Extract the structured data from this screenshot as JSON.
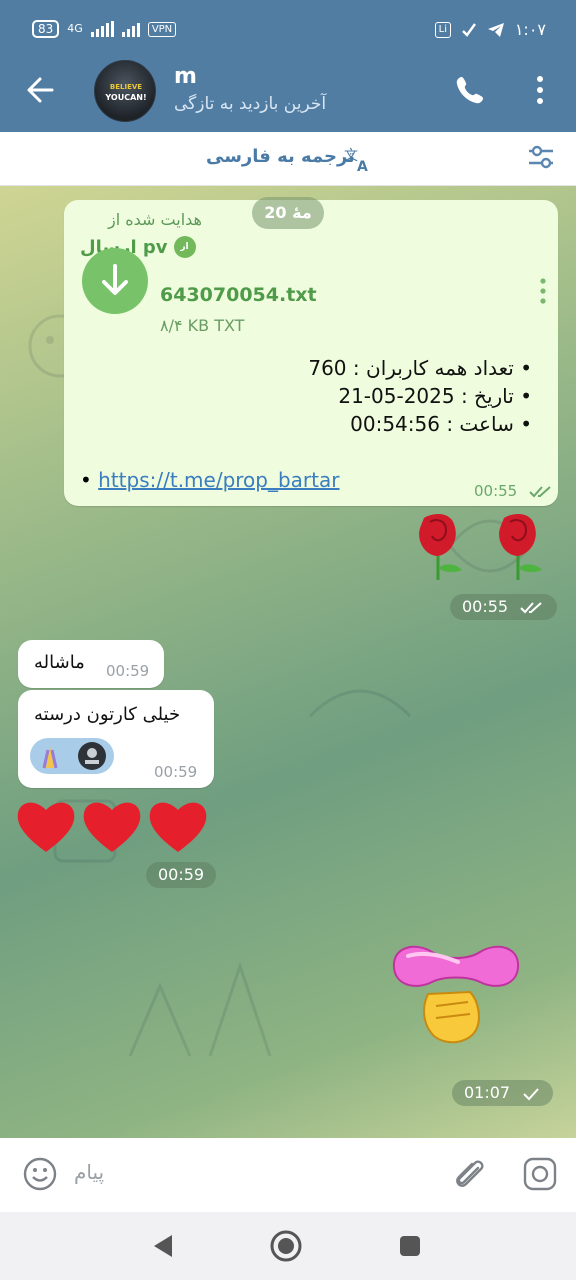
{
  "status_bar": {
    "battery": "83",
    "network": "4G",
    "vpn": "VPN",
    "app_badge": "Li",
    "time": "۱:۰۷"
  },
  "header": {
    "chat_name": "m",
    "last_seen": "آخرین بازدید به تازگی",
    "avatar_line1": "BELIEVE",
    "avatar_line2": "YOUCAN!"
  },
  "translate_bar": {
    "label": "ترجمه به فارسی"
  },
  "messages": {
    "date_pill": "20 مهٔ",
    "forward": {
      "forwarded_from_label": "هدایت شده از",
      "source_name": "ارسال pv",
      "source_badge": "ار",
      "file_name": "643070054.txt",
      "file_meta": "۸/۴ KB TXT",
      "info_lines": [
        "• تعداد همه کاربران : 760",
        "• تاریخ : 2025-05-21",
        "• ساعت : 00:54:56"
      ],
      "link_bullet": "•",
      "link": "https://t.me/prop_bartar",
      "time": "00:55"
    },
    "roses": {
      "time": "00:55"
    },
    "incoming_1": {
      "text": "ماشاله",
      "time": "00:59"
    },
    "incoming_2": {
      "text": "خیلی کارتون درسته",
      "time": "00:59"
    },
    "hearts": {
      "time": "00:59"
    },
    "sticker": {
      "time": "01:07"
    }
  },
  "input_bar": {
    "placeholder": "پیام"
  },
  "colors": {
    "header_bg": "#527da3",
    "outgoing_bubble": "#effdde",
    "accent_green": "#4f9b4a",
    "link": "#3a7dc0"
  }
}
